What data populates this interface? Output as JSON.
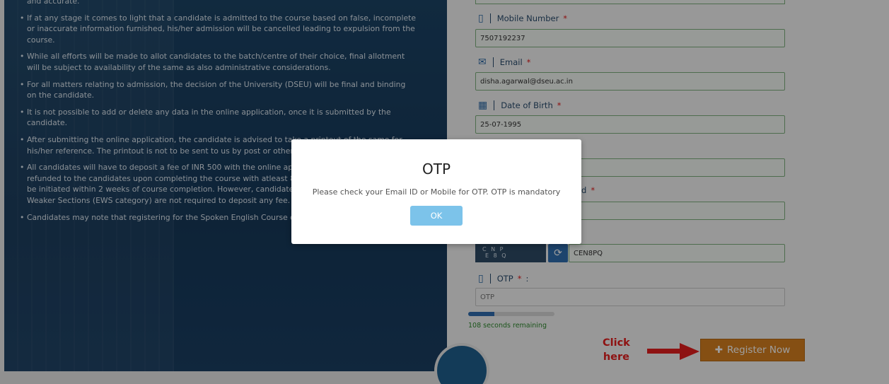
{
  "notes": {
    "first_tail": "and accurate.",
    "items": [
      "If at any stage it comes to light that a candidate is admitted to the course based on false, incomplete or inaccurate information furnished, his/her admission will be cancelled leading to expulsion from the course.",
      "While all efforts will be made to allot candidates to the batch/centre of their choice, final allotment will be subject to availability of the same as also administrative considerations.",
      "For all matters relating to admission, the decision of the University (DSEU) will be final and binding on the candidate.",
      "It is not possible to add or delete any data in the online application, once it is submitted by the candidate.",
      "After submitting the online application, the candidate is advised to take a printout of the same for his/her reference. The printout is not to be sent to us by post or otherwise.",
      "All candidates will have to deposit a fee of INR 500 with the online application. This amount will be refunded to the candidates upon completing the course with atleast 80% attendance. The refund will be initiated within 2 weeks of course completion. However, candidates belonging to Economically Weaker Sections (EWS category) are not required to deposit any fee.",
      "Candidates may note that registering for the Spoken English Course does not guarantee admission."
    ]
  },
  "form": {
    "mobile": {
      "label": "Mobile Number",
      "value": "7507192237"
    },
    "email": {
      "label": "Email",
      "value": "disha.agarwal@dseu.ac.in"
    },
    "dob": {
      "label": "Date of Birth",
      "value": "25-07-1995"
    },
    "password_label_tail": "d",
    "captcha": {
      "image_text_1": "C N P",
      "image_text_2": "E 8 Q",
      "value": "CEN8PQ"
    },
    "otp": {
      "label": "OTP",
      "colon": ":",
      "placeholder": "OTP"
    },
    "timer": {
      "text": "108 seconds remaining",
      "progress": 0.3
    },
    "register_label": "Register Now",
    "required_mark": "*"
  },
  "annotation": {
    "line1": "Click",
    "line2": "here"
  },
  "modal": {
    "title": "OTP",
    "message": "Please check your Email ID or Mobile for OTP. OTP is mandatory",
    "ok_label": "OK"
  },
  "icons": {
    "mobile": "mobile-icon",
    "email": "envelope-icon",
    "dob": "calendar-icon",
    "refresh": "refresh-icon",
    "register": "add-user-icon"
  }
}
